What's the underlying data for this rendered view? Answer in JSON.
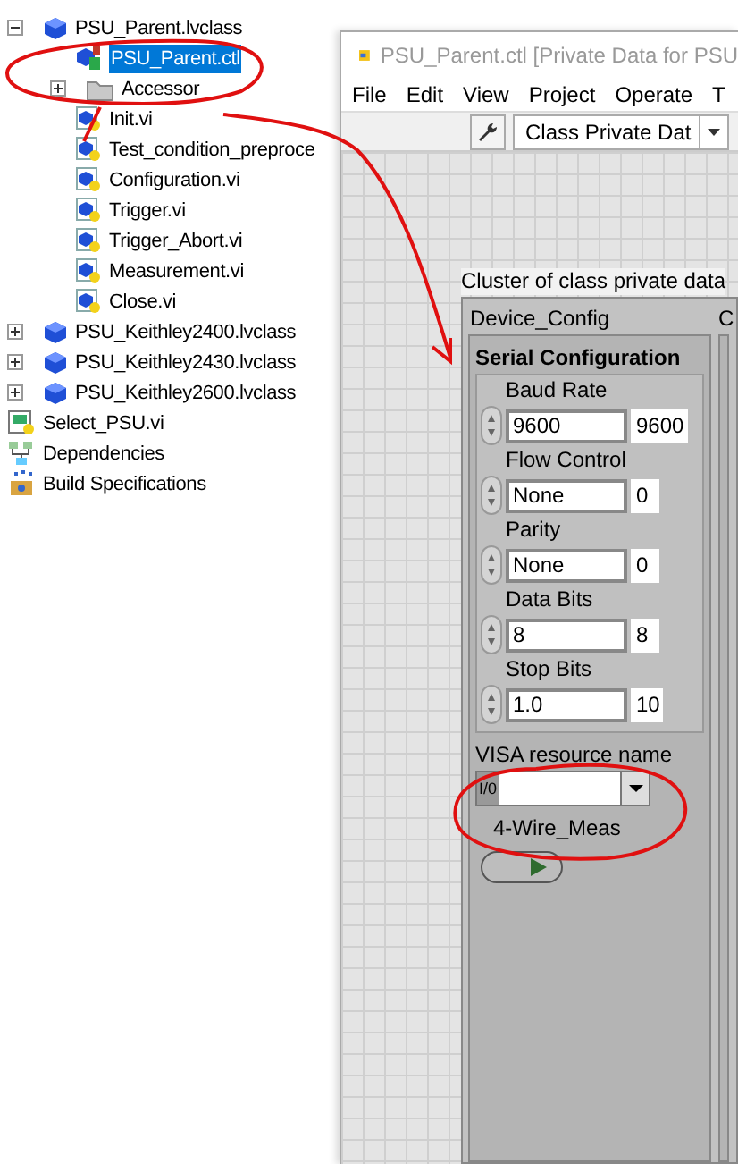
{
  "project_tree": {
    "items": [
      {
        "label": "PSU_Parent.lvclass",
        "kind": "class",
        "expanded": true,
        "selected": false,
        "children": [
          {
            "label": "PSU_Parent.ctl",
            "kind": "ctl",
            "selected": true
          },
          {
            "label": "Accessor",
            "kind": "folder",
            "expanded": false,
            "selected": false
          },
          {
            "label": "Init.vi",
            "kind": "vi",
            "selected": false
          },
          {
            "label": "Test_condition_preproce",
            "kind": "vi",
            "selected": false
          },
          {
            "label": "Configuration.vi",
            "kind": "vi",
            "selected": false
          },
          {
            "label": "Trigger.vi",
            "kind": "vi",
            "selected": false
          },
          {
            "label": "Trigger_Abort.vi",
            "kind": "vi",
            "selected": false
          },
          {
            "label": "Measurement.vi",
            "kind": "vi",
            "selected": false
          },
          {
            "label": "Close.vi",
            "kind": "vi",
            "selected": false
          }
        ]
      },
      {
        "label": "PSU_Keithley2400.lvclass",
        "kind": "class",
        "expanded": false,
        "selected": false
      },
      {
        "label": "PSU_Keithley2430.lvclass",
        "kind": "class",
        "expanded": false,
        "selected": false
      },
      {
        "label": "PSU_Keithley2600.lvclass",
        "kind": "class",
        "expanded": false,
        "selected": false
      },
      {
        "label": "Select_PSU.vi",
        "kind": "topvi",
        "selected": false
      },
      {
        "label": "Dependencies",
        "kind": "deps",
        "selected": false
      },
      {
        "label": "Build Specifications",
        "kind": "build",
        "selected": false
      }
    ]
  },
  "window": {
    "title": "PSU_Parent.ctl [Private Data for PSU",
    "menu": [
      "File",
      "Edit",
      "View",
      "Project",
      "Operate",
      "T"
    ],
    "toolbar": {
      "dropdown": "Class Private Dat"
    },
    "cluster": {
      "label": "Cluster of class private data",
      "column_2_label": "C",
      "device_config": {
        "label": "Device_Config",
        "serial": {
          "title": "Serial Configuration",
          "controls": [
            {
              "label": "Baud Rate",
              "value": "9600",
              "numeric": "9600"
            },
            {
              "label": "Flow Control",
              "value": "None",
              "numeric": "0"
            },
            {
              "label": "Parity",
              "value": "None",
              "numeric": "0"
            },
            {
              "label": "Data Bits",
              "value": "8",
              "numeric": "8"
            },
            {
              "label": "Stop Bits",
              "value": "1.0",
              "numeric": "10"
            }
          ]
        },
        "visa": {
          "label": "VISA resource name",
          "glyph": "I/0"
        },
        "wire": {
          "label": "4-Wire_Meas",
          "on": false
        }
      }
    }
  }
}
